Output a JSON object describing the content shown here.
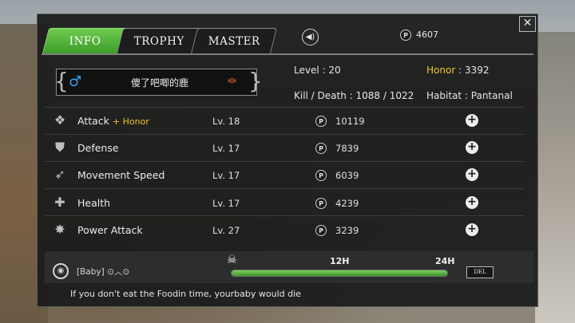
{
  "tabs": [
    {
      "label": "INFO",
      "active": true
    },
    {
      "label": "TROPHY",
      "active": false
    },
    {
      "label": "MASTER",
      "active": false
    }
  ],
  "points": "4607",
  "player": {
    "name": "傻了吧唧的鹿",
    "gender_symbol": "♂",
    "level_label": "Level : 20",
    "kill_death_label": "Kill / Death : 1088 / 1022",
    "honor_label": "Honor",
    "honor_value": " : 3392",
    "habitat_label": "Habitat : Pantanal"
  },
  "skills": [
    {
      "name": "Attack",
      "bonus": "+ Honor",
      "level": "Lv. 18",
      "cost": "10119",
      "icon": "claw-icon"
    },
    {
      "name": "Defense",
      "bonus": "",
      "level": "Lv. 17",
      "cost": "7839",
      "icon": "shield-icon"
    },
    {
      "name": "Movement Speed",
      "bonus": "",
      "level": "Lv. 17",
      "cost": "6039",
      "icon": "wing-icon"
    },
    {
      "name": "Health",
      "bonus": "",
      "level": "Lv. 17",
      "cost": "4239",
      "icon": "cross-icon"
    },
    {
      "name": "Power Attack",
      "bonus": "",
      "level": "Lv. 27",
      "cost": "3239",
      "icon": "burst-icon"
    }
  ],
  "baby": {
    "label": "[Baby]",
    "face": "⊙︿⊙",
    "time_mid": "12H",
    "time_end": "24H",
    "food_progress": 1.0,
    "del_label": "DEL"
  },
  "hint": "If you don't eat the Foodin time, yourbaby would die",
  "coin_symbol": "P",
  "colors": {
    "accent_green": "#4caf35",
    "honor_gold": "#f0c232",
    "gender_blue": "#35a0f0"
  }
}
